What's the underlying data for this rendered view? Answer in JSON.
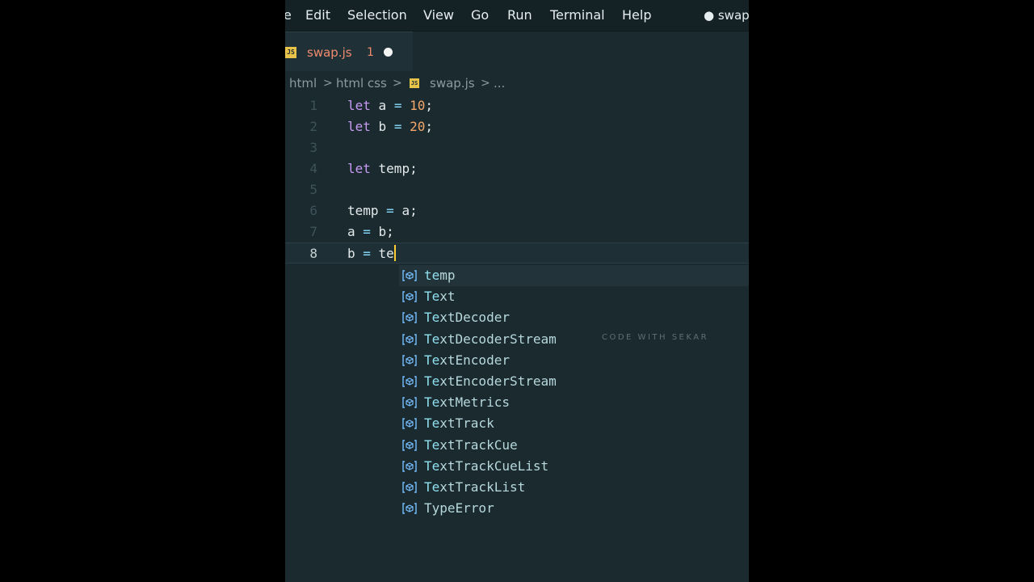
{
  "menu": {
    "items": [
      {
        "label": "e"
      },
      {
        "label": "Edit"
      },
      {
        "label": "Selection"
      },
      {
        "label": "View"
      },
      {
        "label": "Go"
      },
      {
        "label": "Run"
      },
      {
        "label": "Terminal"
      },
      {
        "label": "Help"
      }
    ],
    "window_title": "● swap.j"
  },
  "tab": {
    "icon": "js-file-icon",
    "badge": "JS",
    "name": "swap.js",
    "problems_count": "1",
    "unsaved_indicator": "modified-dot-icon"
  },
  "breadcrumb": {
    "items": [
      "html",
      "html css",
      "swap.js",
      "..."
    ],
    "separator": ">",
    "badge": "JS"
  },
  "editor": {
    "lines": [
      {
        "number": "1",
        "tokens": [
          {
            "t": "let",
            "c": "kw"
          },
          {
            "t": " a ",
            "c": ""
          },
          {
            "t": "=",
            "c": "op"
          },
          {
            "t": " ",
            "c": ""
          },
          {
            "t": "10",
            "c": "num"
          },
          {
            "t": ";",
            "c": ""
          }
        ]
      },
      {
        "number": "2",
        "tokens": [
          {
            "t": "let",
            "c": "kw"
          },
          {
            "t": " b ",
            "c": ""
          },
          {
            "t": "=",
            "c": "op"
          },
          {
            "t": " ",
            "c": ""
          },
          {
            "t": "20",
            "c": "num"
          },
          {
            "t": ";",
            "c": ""
          }
        ]
      },
      {
        "number": "3",
        "tokens": []
      },
      {
        "number": "4",
        "tokens": [
          {
            "t": "let",
            "c": "kw"
          },
          {
            "t": " temp;",
            "c": ""
          }
        ]
      },
      {
        "number": "5",
        "tokens": []
      },
      {
        "number": "6",
        "tokens": [
          {
            "t": "temp ",
            "c": ""
          },
          {
            "t": "=",
            "c": "op"
          },
          {
            "t": " a;",
            "c": ""
          }
        ]
      },
      {
        "number": "7",
        "tokens": [
          {
            "t": "a ",
            "c": ""
          },
          {
            "t": "=",
            "c": "op"
          },
          {
            "t": " b;",
            "c": ""
          }
        ]
      },
      {
        "number": "8",
        "tokens": [
          {
            "t": "b ",
            "c": ""
          },
          {
            "t": "=",
            "c": "op"
          },
          {
            "t": " te",
            "c": ""
          }
        ]
      }
    ],
    "active_line": "8"
  },
  "suggestions": {
    "typed_prefix": "Te",
    "items": [
      {
        "label": "temp",
        "icon": "variable-icon"
      },
      {
        "label": "Text",
        "icon": "variable-icon"
      },
      {
        "label": "TextDecoder",
        "icon": "variable-icon"
      },
      {
        "label": "TextDecoderStream",
        "icon": "variable-icon"
      },
      {
        "label": "TextEncoder",
        "icon": "variable-icon"
      },
      {
        "label": "TextEncoderStream",
        "icon": "variable-icon"
      },
      {
        "label": "TextMetrics",
        "icon": "variable-icon"
      },
      {
        "label": "TextTrack",
        "icon": "variable-icon"
      },
      {
        "label": "TextTrackCue",
        "icon": "variable-icon"
      },
      {
        "label": "TextTrackCueList",
        "icon": "variable-icon"
      },
      {
        "label": "TextTrackList",
        "icon": "variable-icon"
      },
      {
        "label": "TypeError",
        "icon": "variable-icon"
      }
    ],
    "selected_index": 0
  },
  "watermark": "CODE WITH SEKAR",
  "colors": {
    "background": "#1b2a2f",
    "keyword": "#c79bf2",
    "number": "#f5a86a",
    "tab_modified": "#f28b6e",
    "js_badge": "#e8c34a",
    "cursor": "#ffcc33"
  }
}
